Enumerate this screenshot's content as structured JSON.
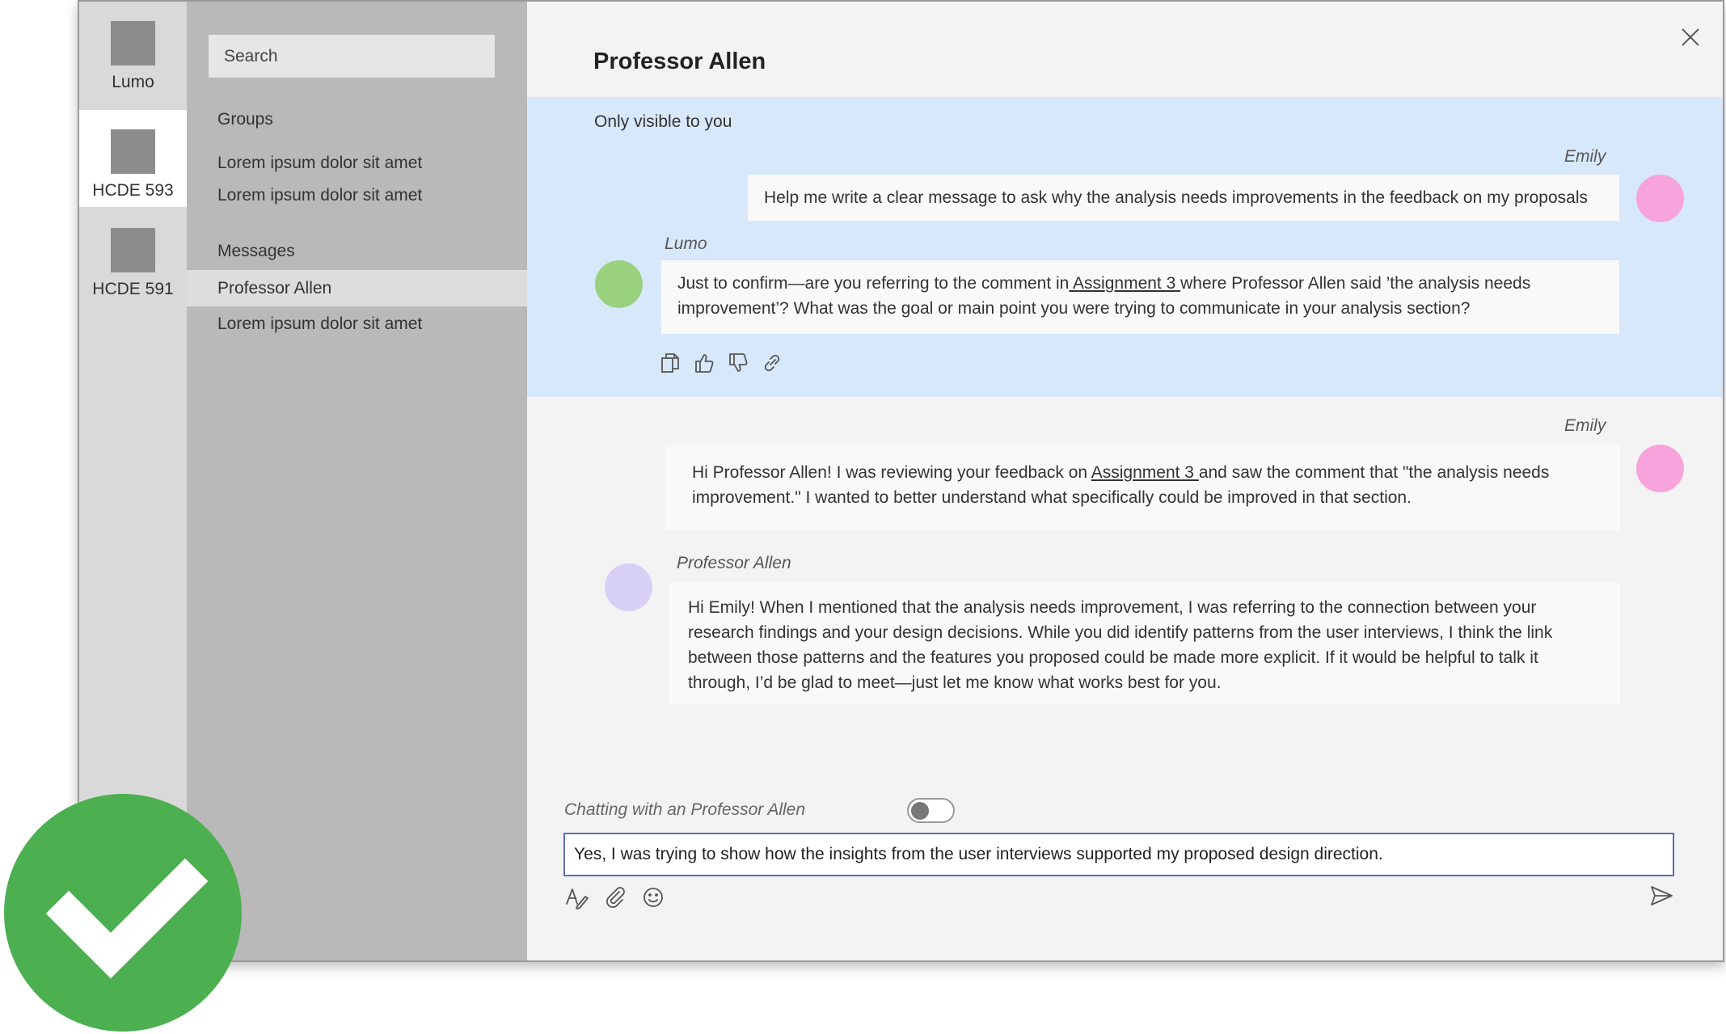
{
  "rail": {
    "items": [
      {
        "label": "Lumo"
      },
      {
        "label": "HCDE 593"
      },
      {
        "label": "HCDE 591"
      }
    ]
  },
  "list": {
    "search_placeholder": "Search",
    "groups_heading": "Groups",
    "groups": [
      "Lorem ipsum dolor sit amet",
      "Lorem ipsum dolor sit amet"
    ],
    "messages_heading": "Messages",
    "messages": [
      "Professor Allen",
      "Lorem ipsum dolor sit amet"
    ]
  },
  "chat": {
    "title": "Professor Allen",
    "private_label": "Only visible to you",
    "msg1": {
      "sender": "Emily",
      "text": "Help me write a clear message to ask why the analysis needs improvements in the feedback on my proposals"
    },
    "msg2": {
      "sender": "Lumo",
      "pre": "Just to confirm—are you referring to the comment in",
      "link": " Assignment 3 ",
      "post": "where Professor Allen said ’the analysis needs improvement’? What was the goal or main point you were trying to communicate in your analysis section?"
    },
    "msg3": {
      "sender": "Emily",
      "pre": "Hi Professor Allen! I was reviewing your feedback on ",
      "link": "Assignment 3 ",
      "post": "and saw the comment that \"the analysis needs improvement.\" I wanted to better understand what specifically could be improved in that section."
    },
    "msg4": {
      "sender": "Professor Allen",
      "text": "Hi Emily! When I mentioned that the analysis needs improvement, I was referring to the connection between your research findings and your design decisions. While you did identify patterns from the user interviews, I think the link between those patterns and the features you proposed could be made more explicit. If it would be helpful to talk it through, I’d be glad to meet—just let me know what works best for you."
    },
    "toggle_label": "Chatting with an Professor Allen",
    "toggle_on": false,
    "composer_value": "Yes, I was trying to show how the insights from the user interviews supported my proposed design direction."
  },
  "icons": [
    "copy-icon",
    "thumbs-up-icon",
    "thumbs-down-icon",
    "link-icon",
    "format-icon",
    "attach-icon",
    "emoji-icon",
    "send-icon",
    "close-icon",
    "checkmark-icon"
  ],
  "colors": {
    "private_bg": "#d8e8fb",
    "avatar_emily": "#f7a4dc",
    "avatar_lumo": "#99d17d",
    "avatar_allen": "#d8cff6",
    "check_green": "#4caf50",
    "composer_border": "#5b6fb5"
  }
}
